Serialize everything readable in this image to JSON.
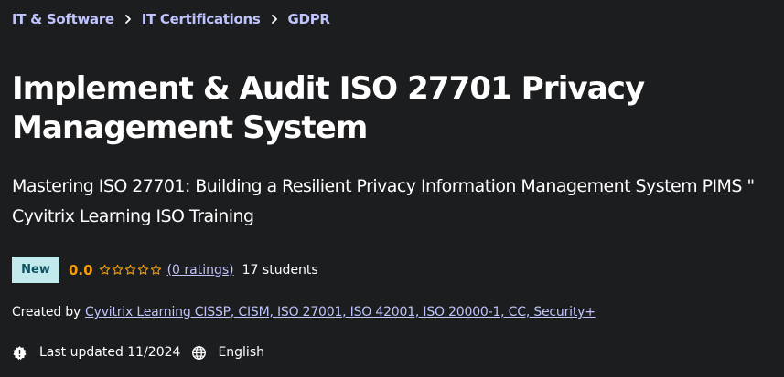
{
  "breadcrumb": {
    "items": [
      {
        "label": "IT & Software"
      },
      {
        "label": "IT Certifications"
      },
      {
        "label": "GDPR"
      }
    ]
  },
  "course": {
    "title": "Implement & Audit ISO 27701 Privacy Management System",
    "subtitle": "Mastering ISO 27701: Building a Resilient Privacy Information Management System PIMS \" Cyvitrix Learning ISO Training"
  },
  "rating": {
    "badge": "New",
    "value": "0.0",
    "stars_filled": 0,
    "stars_total": 5,
    "ratings_link": "(0 ratings)",
    "students": "17 students"
  },
  "created": {
    "label": "Created by",
    "instructor": "Cyvitrix Learning CISSP, CISM, ISO 27001, ISO 42001, ISO 20000-1, CC, Security+"
  },
  "meta": {
    "last_updated": "Last updated 11/2024",
    "language": "English",
    "icons": [
      "alert-badge-icon",
      "globe-icon"
    ]
  },
  "colors": {
    "background": "#1c1d1f",
    "link": "#c0c4fc",
    "rating": "#f69c08",
    "badge_bg": "#c2e9eb",
    "badge_text": "#0d5261"
  }
}
